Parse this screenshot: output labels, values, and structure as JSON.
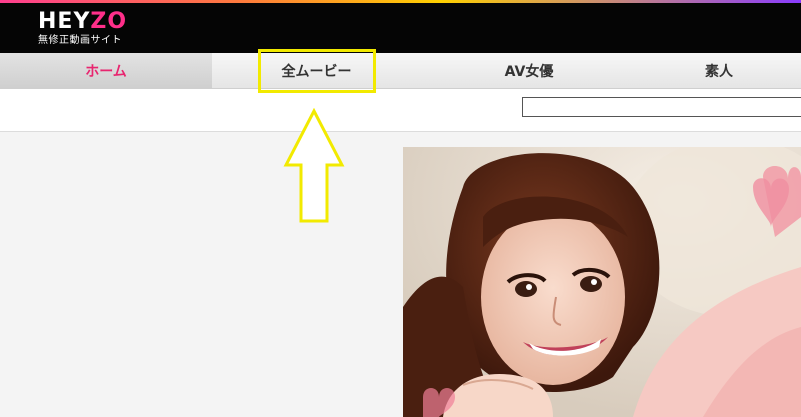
{
  "header": {
    "logo_prefix": "HEY",
    "logo_suffix": "ZO",
    "tagline": "無修正動画サイト",
    "brand_color": "#ff2f8a"
  },
  "nav": {
    "items": [
      {
        "label": "ホーム",
        "active": true
      },
      {
        "label": "全ムービー",
        "active": false
      },
      {
        "label": "AV女優",
        "active": false
      },
      {
        "label": "素人",
        "active": false
      }
    ]
  },
  "search": {
    "value": ""
  },
  "annotation": {
    "highlight_color": "#f2ea00",
    "arrow_icon": "up-arrow-icon"
  },
  "colors": {
    "active_nav": "#e8256f",
    "background": "#f4f4f4"
  }
}
